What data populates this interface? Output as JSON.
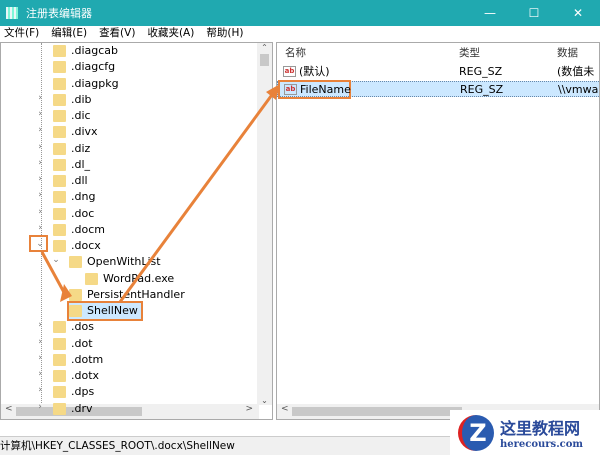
{
  "window": {
    "title": "注册表编辑器",
    "min": "—",
    "max": "☐",
    "close": "✕"
  },
  "menu": [
    "文件(F)",
    "编辑(E)",
    "查看(V)",
    "收藏夹(A)",
    "帮助(H)"
  ],
  "tree": [
    {
      "label": ".diagcab",
      "chev": ""
    },
    {
      "label": ".diagcfg",
      "chev": ""
    },
    {
      "label": ".diagpkg",
      "chev": ""
    },
    {
      "label": ".dib",
      "chev": ">"
    },
    {
      "label": ".dic",
      "chev": ">"
    },
    {
      "label": ".divx",
      "chev": ">"
    },
    {
      "label": ".diz",
      "chev": ">"
    },
    {
      "label": ".dl_",
      "chev": ">"
    },
    {
      "label": ".dll",
      "chev": ">"
    },
    {
      "label": ".dng",
      "chev": ">"
    },
    {
      "label": ".doc",
      "chev": ">"
    },
    {
      "label": ".docm",
      "chev": ">"
    },
    {
      "label": ".docx",
      "chev": "v"
    },
    {
      "label": "OpenWithList",
      "chev": "v",
      "level": 1
    },
    {
      "label": "WordPad.exe",
      "chev": "",
      "level": 2
    },
    {
      "label": "PersistentHandler",
      "chev": "",
      "level": 1
    },
    {
      "label": "ShellNew",
      "chev": "",
      "level": 1,
      "selected": true
    },
    {
      "label": ".dos",
      "chev": ">"
    },
    {
      "label": ".dot",
      "chev": ">"
    },
    {
      "label": ".dotm",
      "chev": ">"
    },
    {
      "label": ".dotx",
      "chev": ">"
    },
    {
      "label": ".dps",
      "chev": ">"
    },
    {
      "label": ".drv",
      "chev": ">"
    }
  ],
  "columns": {
    "name": "名称",
    "type": "类型",
    "data": "数据"
  },
  "values": [
    {
      "name": "(默认)",
      "type": "REG_SZ",
      "data": "(数值未设"
    },
    {
      "name": "FileName",
      "type": "REG_SZ",
      "data": "\\\\vmware"
    }
  ],
  "status": "计算机\\HKEY_CLASSES_ROOT\\.docx\\ShellNew",
  "watermark": {
    "name": "这里教程网",
    "url": "herecours.com"
  },
  "colors": {
    "titlebar": "#20a9b0",
    "annotation": "#e8823a",
    "selection": "#cce8ff"
  }
}
